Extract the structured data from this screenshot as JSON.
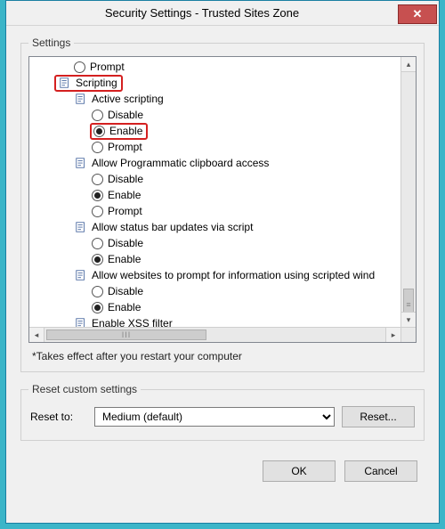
{
  "window": {
    "title": "Security Settings - Trusted Sites Zone"
  },
  "settings": {
    "legend": "Settings",
    "tree": {
      "prompt0": "Prompt",
      "scripting": "Scripting",
      "active_scripting": "Active scripting",
      "as_disable": "Disable",
      "as_enable": "Enable",
      "as_prompt": "Prompt",
      "apca": "Allow Programmatic clipboard access",
      "apca_disable": "Disable",
      "apca_enable": "Enable",
      "apca_prompt": "Prompt",
      "asbu": "Allow status bar updates via script",
      "asbu_disable": "Disable",
      "asbu_enable": "Enable",
      "awp": "Allow websites to prompt for information using scripted wind",
      "awp_disable": "Disable",
      "awp_enable": "Enable",
      "xss": "Enable XSS filter"
    },
    "note": "*Takes effect after you restart your computer"
  },
  "reset": {
    "legend": "Reset custom settings",
    "label": "Reset to:",
    "selected": "Medium (default)",
    "button": "Reset..."
  },
  "footer": {
    "ok": "OK",
    "cancel": "Cancel"
  },
  "hscroll_thumb": "III"
}
